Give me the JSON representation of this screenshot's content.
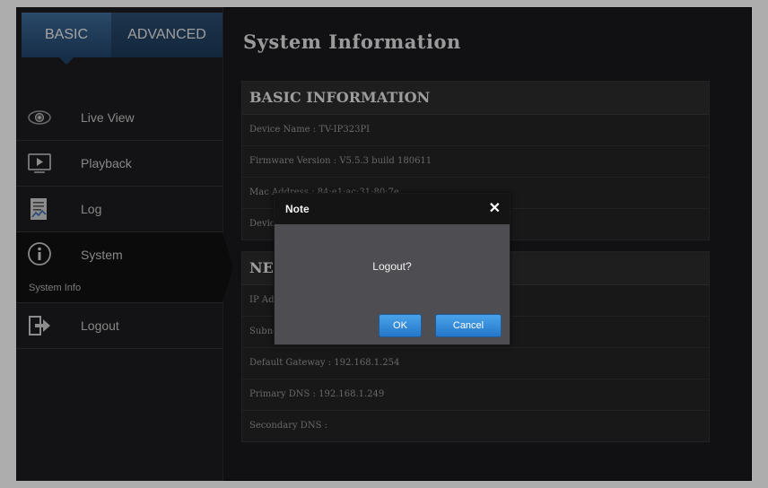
{
  "tabs": {
    "basic": "BASIC",
    "advanced": "ADVANCED"
  },
  "sidebar": {
    "items": [
      {
        "label": "Live View",
        "icon": "eye-icon"
      },
      {
        "label": "Playback",
        "icon": "play-icon"
      },
      {
        "label": "Log",
        "icon": "log-icon"
      },
      {
        "label": "System",
        "icon": "info-icon",
        "sub": "System Info"
      },
      {
        "label": "Logout",
        "icon": "logout-icon"
      }
    ]
  },
  "main": {
    "title": "System Information",
    "basic": {
      "header": "BASIC INFORMATION",
      "rows": [
        "Device Name : TV-IP323PI",
        "Firmware Version : V5.5.3 build 180611",
        "Mac Address : 84:e1:ac:31:80:7e",
        "Device"
      ]
    },
    "network": {
      "header": "NETWORK",
      "rows": [
        "IP Address",
        "Subnet",
        "Default Gateway : 192.168.1.254",
        "Primary DNS : 192.168.1.249",
        "Secondary DNS :"
      ]
    }
  },
  "dialog": {
    "title": "Note",
    "close": "✕",
    "message": "Logout?",
    "ok": "OK",
    "cancel": "Cancel"
  },
  "colors": {
    "accent": "#2f7fd0",
    "tab_active": "#3f6c9a",
    "background": "#1a1a1c"
  }
}
